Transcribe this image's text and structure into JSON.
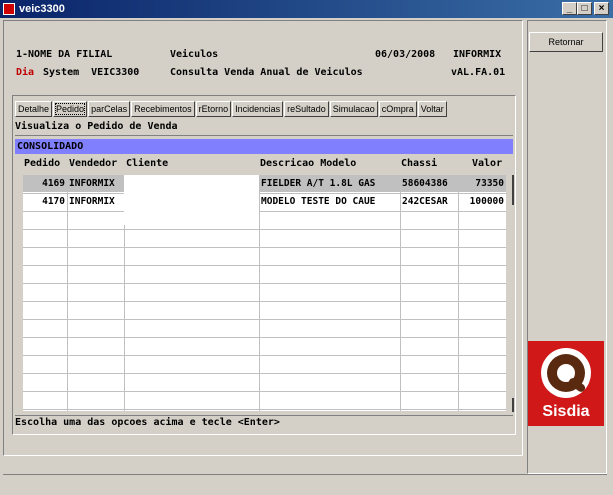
{
  "window": {
    "title": "veic3300",
    "minimize": "_",
    "maximize": "□",
    "close": "×"
  },
  "header": {
    "filial": "1-NOME DA FILIAL",
    "modulo": "Veiculos",
    "data": "06/03/2008",
    "informix": "INFORMIX",
    "dia": "Dia",
    "system": "System  VEIC3300",
    "consulta": "Consulta Venda Anual de Veiculos",
    "versao": "vAL.FA.01"
  },
  "tabs": [
    "Detalhe",
    "Pedido",
    "parCelas",
    "Recebimentos",
    "rEtorno",
    "Incidencias",
    "reSultado",
    "Simulacao",
    "cOmpra",
    "Voltar"
  ],
  "active_tab": "Pedido",
  "subtitle": "Visualiza o Pedido de Venda",
  "consolidado": "CONSOLIDADO",
  "columns": {
    "pedido": "Pedido",
    "vendedor": "Vendedor",
    "cliente": "Cliente",
    "descricao": "Descricao Modelo",
    "chassi": "Chassi",
    "valor": "Valor"
  },
  "rows": [
    {
      "pedido": "4169",
      "vendedor": "INFORMIX",
      "cliente": "",
      "descricao": "FIELDER A/T 1.8L GAS",
      "chassi": "58604386",
      "valor": "73350"
    },
    {
      "pedido": "4170",
      "vendedor": "INFORMIX",
      "cliente": "",
      "descricao": "MODELO TESTE DO CAUE",
      "chassi": "242CESAR",
      "valor": "100000"
    }
  ],
  "status": "Escolha uma das opcoes acima e tecle <Enter>",
  "right": {
    "retornar": "Retornar",
    "logo_text": "Sisdia"
  },
  "colors": {
    "consolidado_bg": "#8080ff",
    "logo_bg": "#d01818",
    "selected_row": "#c0c0c0"
  }
}
